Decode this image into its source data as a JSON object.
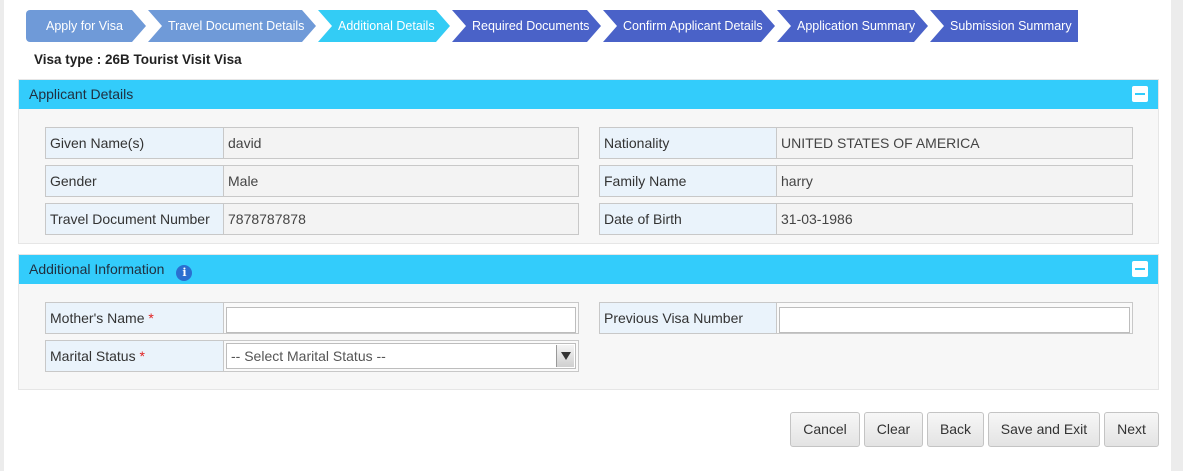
{
  "wizard": {
    "steps": [
      {
        "label": "Apply for Visa",
        "state": "done"
      },
      {
        "label": "Travel Document Details",
        "state": "done"
      },
      {
        "label": "Additional Details",
        "state": "current"
      },
      {
        "label": "Required Documents",
        "state": "todo"
      },
      {
        "label": "Confirm Applicant Details",
        "state": "todo"
      },
      {
        "label": "Application Summary",
        "state": "todo"
      },
      {
        "label": "Submission Summary",
        "state": "todo"
      }
    ]
  },
  "visa_type": "Visa type  : 26B Tourist Visit Visa",
  "applicant": {
    "title": "Applicant Details",
    "given_name_label": "Given Name(s)",
    "given_name": "david",
    "nationality_label": "Nationality",
    "nationality": "UNITED STATES OF AMERICA",
    "gender_label": "Gender",
    "gender": "Male",
    "family_name_label": "Family Name",
    "family_name": "harry",
    "doc_number_label": "Travel Document Number",
    "doc_number": "7878787878",
    "dob_label": "Date of Birth",
    "dob": "31-03-1986"
  },
  "additional": {
    "title": "Additional Information",
    "info_icon": "info-icon",
    "mother_label": "Mother's Name",
    "mother_value": "",
    "prev_visa_label": "Previous Visa Number",
    "prev_visa_value": "",
    "marital_label": "Marital Status",
    "marital_selected": "-- Select Marital Status --",
    "required_mark": "*"
  },
  "actions": {
    "cancel": "Cancel",
    "clear": "Clear",
    "back": "Back",
    "save_exit": "Save and Exit",
    "next": "Next"
  },
  "colors": {
    "step_done": "#6f9ad8",
    "step_current": "#33ccf5",
    "step_todo": "#4a62c8",
    "panel_header": "#33ccfb"
  }
}
